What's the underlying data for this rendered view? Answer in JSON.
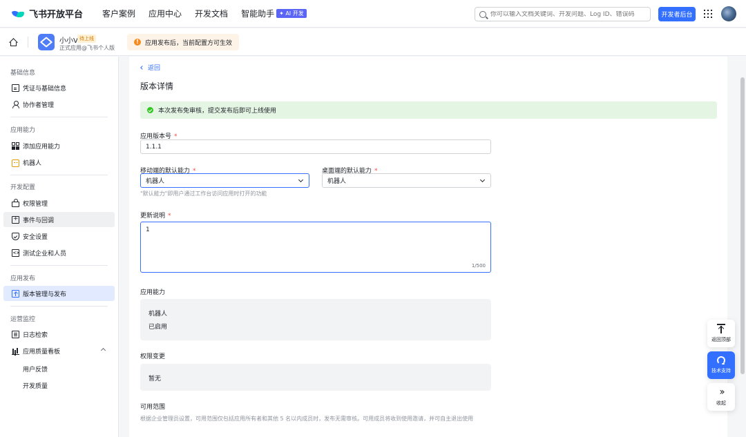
{
  "topbar": {
    "logo_text": "飞书开放平台",
    "nav": [
      "客户案例",
      "应用中心",
      "开发文档",
      "智能助手"
    ],
    "ai_badge": "✦ AI 开发",
    "search_placeholder": "你可以输入文档关键词、开发问题、Log ID、错误码",
    "dev_console": "开发者后台"
  },
  "appbar": {
    "app_name": "小小V",
    "app_status": "待上线",
    "app_sub": "正式应用@飞书个人版",
    "notice": "应用发布后，当前配置方可生效"
  },
  "sidebar": {
    "groups": {
      "basic": "基础信息",
      "ability": "应用能力",
      "dev": "开发配置",
      "publish": "应用发布",
      "ops": "运营监控"
    },
    "items": {
      "credentials": "凭证与基础信息",
      "collaborators": "协作者管理",
      "add_ability": "添加应用能力",
      "bot": "机器人",
      "permissions": "权限管理",
      "events": "事件与回调",
      "security": "安全设置",
      "test_org": "测试企业和人员",
      "version": "版本管理与发布",
      "logs": "日志检索",
      "quality": "应用质量看板",
      "feedback": "用户反馈",
      "dev_quality": "开发质量"
    }
  },
  "main": {
    "back": "返回",
    "title": "版本详情",
    "success_msg": "本次发布免审核，提交发布后即可上线使用",
    "version_label": "应用版本号",
    "version_value": "1.1.1",
    "mobile_label": "移动端的默认能力",
    "mobile_value": "机器人",
    "desktop_label": "桌面端的默认能力",
    "desktop_value": "机器人",
    "default_hint": "\"默认能力\"即用户通过工作台访问应用时打开的功能",
    "notes_label": "更新说明",
    "notes_value": "1",
    "notes_counter": "1/500",
    "ability_label": "应用能力",
    "ability_name": "机器人",
    "ability_status": "已启用",
    "perm_label": "权限变更",
    "perm_value": "暂无",
    "scope_label": "可用范围",
    "scope_desc": "根据企业管理员设置，可用范围仅包括应用所有者和其他 5 名以内成员时，发布无需审核。可用成员将收到使用邀请，并可自主退出使用",
    "required_mark": "*"
  },
  "floating": {
    "top": "返回顶部",
    "support": "技术支持",
    "collapse": "收起"
  }
}
